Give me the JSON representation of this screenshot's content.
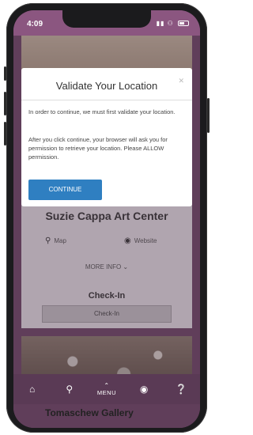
{
  "status_bar": {
    "time": "4:09",
    "icons": "▮▮ ⚇"
  },
  "modal": {
    "title": "Validate Your Location",
    "close_icon": "close-icon",
    "paragraph1": "In order to continue, we must first validate your location.",
    "paragraph2": "After you click continue, your browser will ask you for permission to retrieve your location. Please ALLOW permission.",
    "continue_label": "CONTINUE"
  },
  "venue": {
    "name": "Suzie Cappa Art Center",
    "map_label": "Map",
    "website_label": "Website",
    "more_info_label": "MORE INFO ⌄",
    "checkin_title": "Check-In",
    "checkin_button": "Check-In"
  },
  "peek_title": "Tomaschew Gallery",
  "bottom_nav": {
    "menu_label": "MENU",
    "icons": [
      "home-icon",
      "location-pin-icon",
      "menu-icon",
      "globe-icon",
      "help-icon"
    ]
  },
  "colors": {
    "accent": "#2f7fc1",
    "nav": "#5a3a55",
    "header": "#8b5680"
  }
}
